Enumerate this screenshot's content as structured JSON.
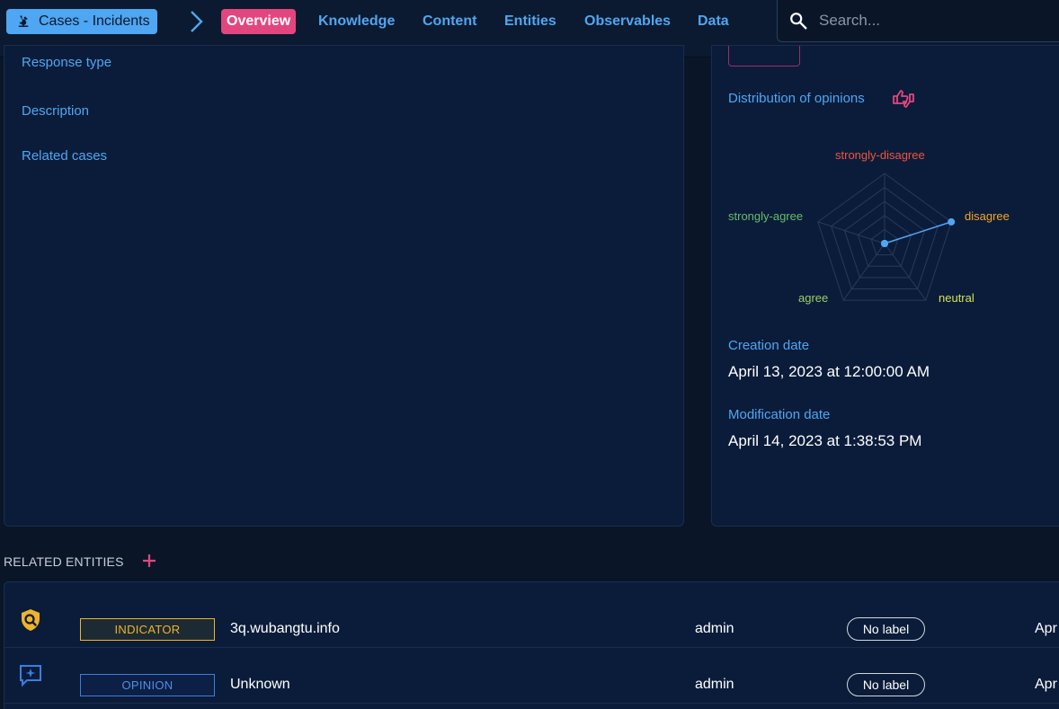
{
  "header": {
    "breadcrumb_label": "Cases - Incidents",
    "tabs": [
      {
        "label": "Overview",
        "active": true
      },
      {
        "label": "Knowledge",
        "active": false
      },
      {
        "label": "Content",
        "active": false
      },
      {
        "label": "Entities",
        "active": false
      },
      {
        "label": "Observables",
        "active": false
      },
      {
        "label": "Data",
        "active": false
      }
    ],
    "search_placeholder": "Search..."
  },
  "details": {
    "response_type_label": "Response type",
    "description_label": "Description",
    "related_cases_label": "Related cases"
  },
  "meta": {
    "distribution_label": "Distribution of opinions",
    "creation_label": "Creation date",
    "creation_value": "April 13, 2023 at 12:00:00 AM",
    "modification_label": "Modification date",
    "modification_value": "April 14, 2023 at 1:38:53 PM"
  },
  "chart_data": {
    "type": "radar",
    "categories": [
      "strongly-disagree",
      "disagree",
      "neutral",
      "agree",
      "strongly-agree"
    ],
    "category_colors": [
      "#f0543c",
      "#f5a623",
      "#d4e157",
      "#9ccc65",
      "#66bb6a"
    ],
    "values": [
      0,
      1,
      0,
      0,
      0
    ],
    "range": [
      0,
      1
    ],
    "series_color": "#4fa6f2",
    "grid": true,
    "legend": false
  },
  "related": {
    "title": "RELATED ENTITIES",
    "rows": [
      {
        "icon": "indicator-icon",
        "type": "INDICATOR",
        "name": "3q.wubangtu.info",
        "creator": "admin",
        "label": "No label",
        "date": "Apr"
      },
      {
        "icon": "opinion-icon",
        "type": "OPINION",
        "name": "Unknown",
        "creator": "admin",
        "label": "No label",
        "date": "Apr"
      }
    ]
  },
  "colors": {
    "accent": "#4fa6f2",
    "active_tab": "#e3467f",
    "indicator": "#f0b429",
    "opinion": "#3b7ee0"
  }
}
